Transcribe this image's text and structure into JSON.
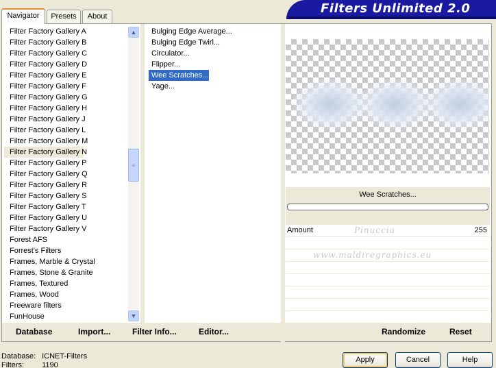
{
  "tabs": [
    {
      "label": "Navigator",
      "active": true
    },
    {
      "label": "Presets",
      "active": false
    },
    {
      "label": "About",
      "active": false
    }
  ],
  "banner": {
    "title": "Filters Unlimited 2.0"
  },
  "categories": [
    "Filter Factory Gallery A",
    "Filter Factory Gallery B",
    "Filter Factory Gallery C",
    "Filter Factory Gallery D",
    "Filter Factory Gallery E",
    "Filter Factory Gallery F",
    "Filter Factory Gallery G",
    "Filter Factory Gallery H",
    "Filter Factory Gallery J",
    "Filter Factory Gallery L",
    "Filter Factory Gallery M",
    "Filter Factory Gallery N",
    "Filter Factory Gallery P",
    "Filter Factory Gallery Q",
    "Filter Factory Gallery R",
    "Filter Factory Gallery S",
    "Filter Factory Gallery T",
    "Filter Factory Gallery U",
    "Filter Factory Gallery V",
    "Forest AFS",
    "Forrest's Filters",
    "Frames, Marble & Crystal",
    "Frames, Stone & Granite",
    "Frames, Textured",
    "Frames, Wood",
    "Freeware filters",
    "FunHouse"
  ],
  "selected_category_index": 11,
  "filters": [
    "Bulging Edge Average...",
    "Bulging Edge Twirl...",
    "Circulator...",
    "Flipper...",
    "Wee Scratches...",
    "Yage..."
  ],
  "selected_filter_index": 4,
  "preview": {
    "filter_name": "Wee Scratches..."
  },
  "params": [
    {
      "label": "Amount",
      "value": "255"
    }
  ],
  "watermark": {
    "line1": "Pinuccia",
    "line2": "www.maldiregraphics.eu"
  },
  "toolbar": {
    "database": "Database",
    "import": "Import...",
    "filter_info": "Filter Info...",
    "editor": "Editor...",
    "randomize": "Randomize",
    "reset": "Reset"
  },
  "status": {
    "database_label": "Database:",
    "database_value": "ICNET-Filters",
    "filters_label": "Filters:",
    "filters_value": "1190"
  },
  "buttons": {
    "apply": "Apply",
    "cancel": "Cancel",
    "help": "Help"
  },
  "colors": {
    "selection": "#316ac5",
    "banner": "#1a1aa0",
    "face": "#ece9d8"
  }
}
